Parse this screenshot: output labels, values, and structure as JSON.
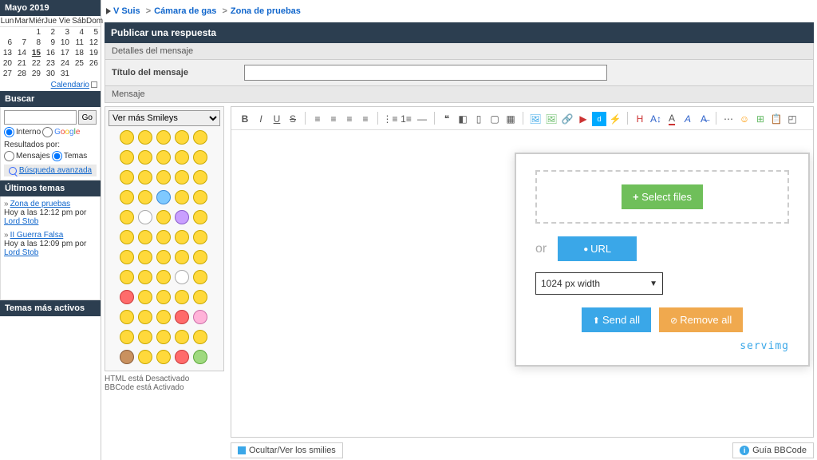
{
  "calendar": {
    "title": "Mayo 2019",
    "days": [
      "Lun",
      "Mar",
      "Miér",
      "Jue",
      "Vie",
      "Sáb",
      "Dom"
    ],
    "link": "Calendario",
    "today": 15
  },
  "search": {
    "title": "Buscar",
    "go": "Go",
    "interno": "Interno",
    "results_by": "Resultados por:",
    "messages": "Mensajes",
    "topics": "Temas",
    "advanced": "Búsqueda avanzada"
  },
  "recent": {
    "title": "Últimos temas",
    "items": [
      {
        "topic": "Zona de pruebas",
        "meta_pre": "Hoy a las 12:12 pm por ",
        "user": "Lord Stob"
      },
      {
        "topic": "II Guerra Falsa",
        "meta_pre": "Hoy a las 12:09 pm por ",
        "user": "Lord Stob"
      }
    ]
  },
  "active": {
    "title": "Temas más activos"
  },
  "breadcrumb": {
    "items": [
      "V Suis",
      "Cámara de gas",
      "Zona de pruebas"
    ]
  },
  "form": {
    "header": "Publicar una respuesta",
    "details": "Detalles del mensaje",
    "title_label": "Título del mensaje",
    "body_label": "Mensaje"
  },
  "smileys": {
    "select_label": "Ver más Smileys",
    "html_off": "HTML está Desactivado",
    "bbcode_on": "BBCode está Activado",
    "list": [
      "y",
      "y",
      "y",
      "y",
      "y",
      "y",
      "y",
      "y",
      "y",
      "y",
      "y",
      "y",
      "y",
      "y",
      "y",
      "y",
      "y",
      "blue",
      "y",
      "y",
      "y",
      "white",
      "y",
      "purple",
      "y",
      "y",
      "y",
      "y",
      "y",
      "y",
      "y",
      "y",
      "y",
      "y",
      "y",
      "y",
      "y",
      "y",
      "white",
      "y",
      "red",
      "y",
      "y",
      "y",
      "y",
      "y",
      "y",
      "y",
      "red",
      "pink",
      "y",
      "y",
      "y",
      "y",
      "y",
      "brown",
      "y",
      "y",
      "red",
      "green"
    ]
  },
  "upload": {
    "select_files": "Select files",
    "or": "or",
    "url": "URL",
    "width": "1024 px width",
    "send_all": "Send all",
    "remove_all": "Remove all",
    "brand": "servimg"
  },
  "bottom": {
    "hide_smilies": "Ocultar/Ver los smilies",
    "bbcode_guide": "Guía BBCode"
  }
}
